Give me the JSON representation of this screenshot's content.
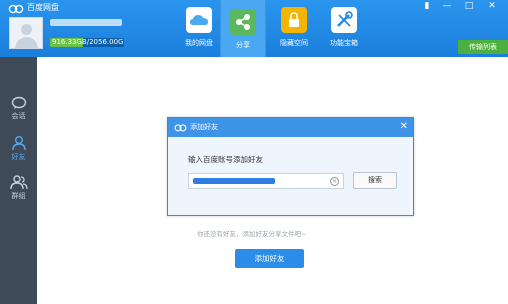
{
  "app": {
    "title": "百度网盘"
  },
  "storage": {
    "used": "916.33GB",
    "total": "/2056.00GB",
    "used_fraction": 0.45,
    "fill_color": "#6cc04a"
  },
  "nav": {
    "tabs": [
      {
        "label": "我的网盘",
        "icon": "cloud-icon"
      },
      {
        "label": "分享",
        "icon": "share-icon"
      },
      {
        "label": "隐藏空间",
        "icon": "lock-icon"
      },
      {
        "label": "功能宝箱",
        "icon": "tools-icon"
      }
    ],
    "active": "分享"
  },
  "window": {
    "menu": "▮",
    "minimize": "—",
    "maximize": "□",
    "close": "✕"
  },
  "transfer": {
    "label": "传输列表"
  },
  "sidebar": {
    "items": [
      {
        "label": "会话",
        "icon": "chat-icon"
      },
      {
        "label": "好友",
        "icon": "friend-icon"
      },
      {
        "label": "群组",
        "icon": "group-icon"
      }
    ]
  },
  "dialog": {
    "title": "添加好友",
    "close": "✕",
    "prompt": "输入百度账号添加好友",
    "search_button": "搜索"
  },
  "hint": "你还没有好友，添加好友分享文件吧~",
  "add_friend_button": "添加好友",
  "colors": {
    "accent": "#1e88e5",
    "sidebar": "#3e4a57",
    "transfer": "#4caf3f"
  }
}
